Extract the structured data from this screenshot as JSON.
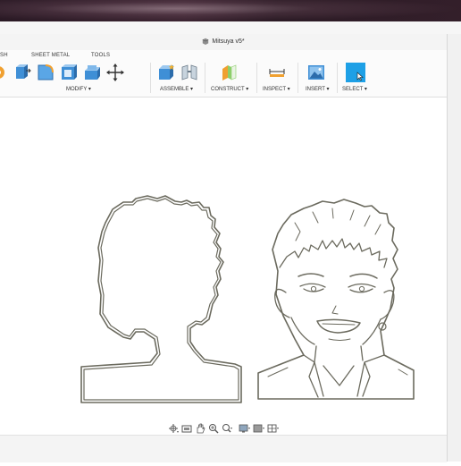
{
  "window": {
    "title": "Mitsuya v5*"
  },
  "toolbar": {
    "tabs": [
      "SH",
      "SHEET METAL",
      "TOOLS"
    ],
    "groups": {
      "modify": "MODIFY ▾",
      "assemble": "ASSEMBLE ▾",
      "construct": "CONSTRUCT ▾",
      "inspect": "INSPECT ▾",
      "insert": "INSERT ▾",
      "select": "SELECT ▾"
    }
  },
  "icons": {
    "press_pull": "press-pull-icon",
    "fillet": "fillet-icon",
    "shell": "shell-icon",
    "combine": "combine-icon",
    "move": "move-icon",
    "new_component": "new-component-icon",
    "joint": "joint-icon",
    "offset_plane": "offset-plane-icon",
    "measure": "measure-icon",
    "insert_image": "insert-image-icon",
    "select": "select-cursor-icon"
  },
  "colors": {
    "select_active": "#1ea0e6",
    "sketch_line": "#6b6a5e"
  }
}
